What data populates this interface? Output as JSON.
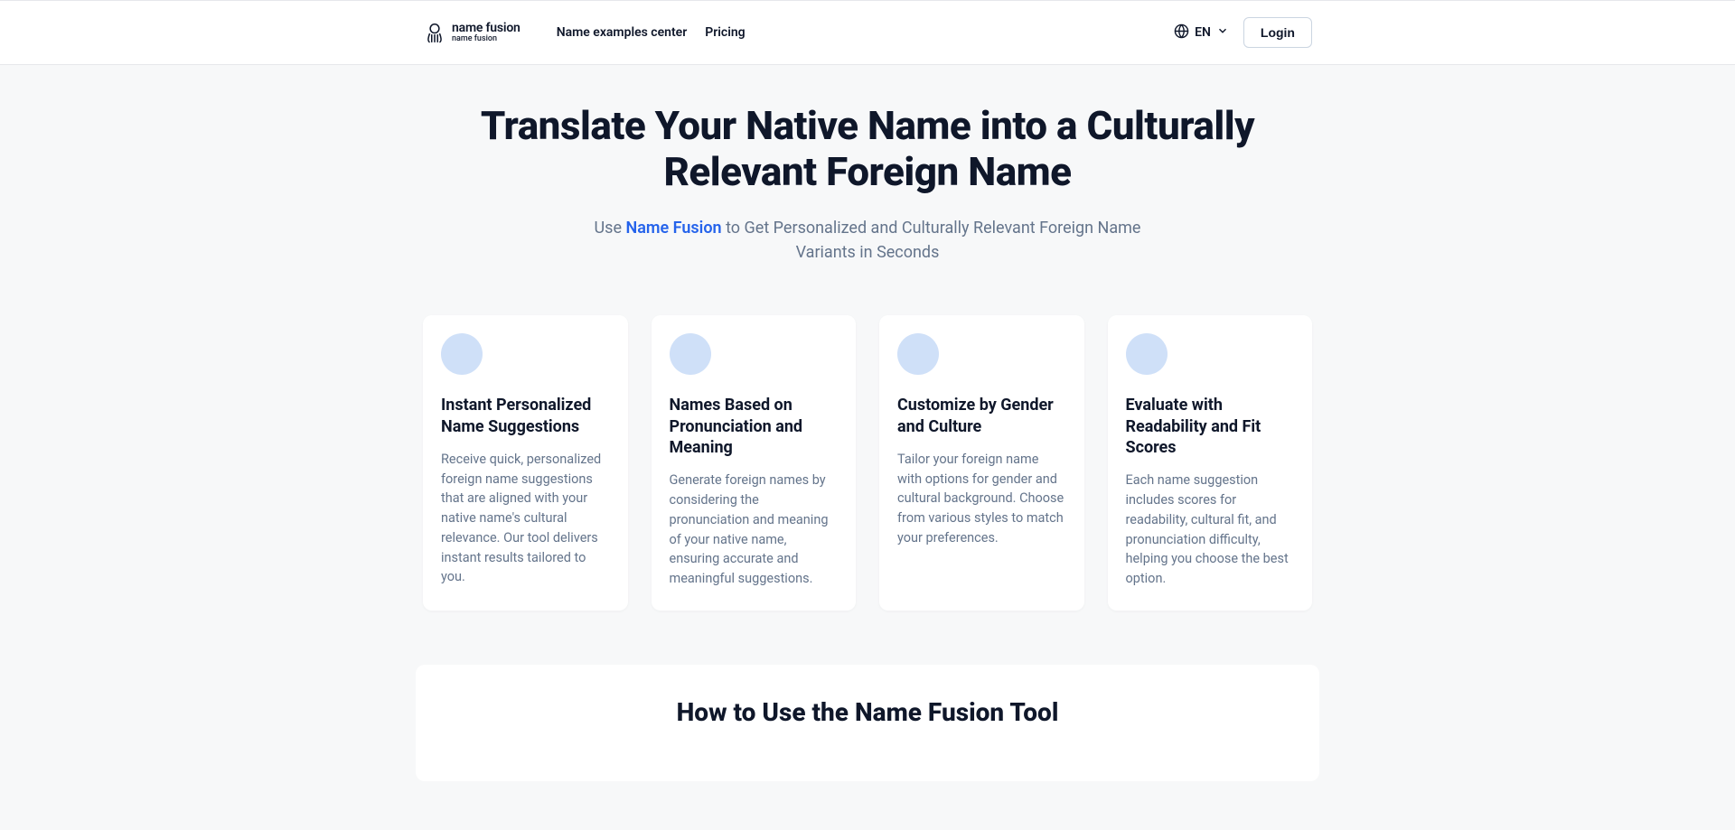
{
  "header": {
    "logo_line1": "name fusion",
    "logo_line2": "name fusion",
    "nav": {
      "examples": "Name examples center",
      "pricing": "Pricing"
    },
    "lang_label": "EN",
    "login_label": "Login"
  },
  "hero": {
    "title": "Translate Your Native Name into a Culturally Relevant Foreign Name",
    "sub_prefix": "Use ",
    "sub_brand": "Name Fusion",
    "sub_suffix": " to Get Personalized and Culturally Relevant Foreign Name Variants in Seconds"
  },
  "features": [
    {
      "title": "Instant Personalized Name Suggestions",
      "desc": "Receive quick, personalized foreign name suggestions that are aligned with your native name's cultural relevance. Our tool delivers instant results tailored to you."
    },
    {
      "title": "Names Based on Pronunciation and Meaning",
      "desc": "Generate foreign names by considering the pronunciation and meaning of your native name, ensuring accurate and meaningful suggestions."
    },
    {
      "title": "Customize by Gender and Culture",
      "desc": "Tailor your foreign name with options for gender and cultural background. Choose from various styles to match your preferences."
    },
    {
      "title": "Evaluate with Readability and Fit Scores",
      "desc": "Each name suggestion includes scores for readability, cultural fit, and pronunciation difficulty, helping you choose the best option."
    }
  ],
  "howto": {
    "title": "How to Use the Name Fusion Tool"
  }
}
